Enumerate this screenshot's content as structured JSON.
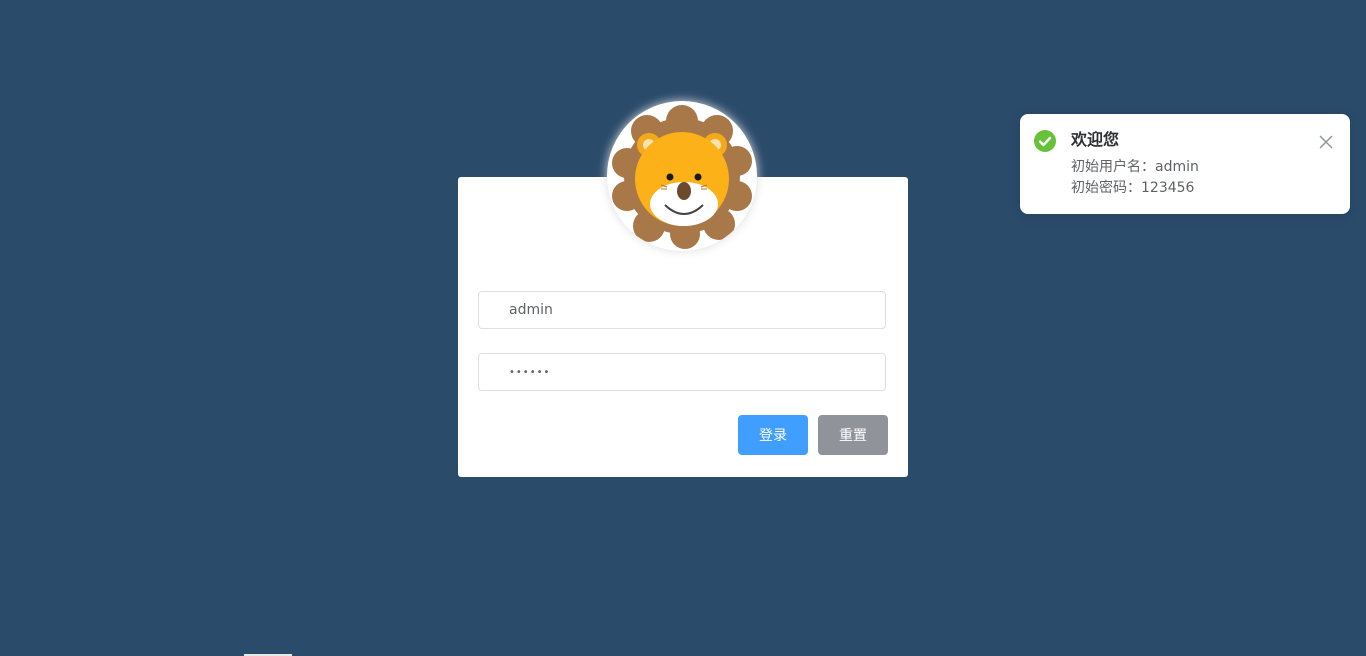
{
  "login_form": {
    "username_value": "admin",
    "password_value": "123456",
    "login_button_label": "登录",
    "reset_button_label": "重置"
  },
  "notification": {
    "title": "欢迎您",
    "line1": "初始用户名：admin",
    "line2": "初始密码：123456",
    "icon": "success-check-icon",
    "close_icon": "close-icon"
  },
  "avatar": {
    "icon": "lion-avatar"
  },
  "colors": {
    "background": "#2b4b6b",
    "primary": "#409eff",
    "info": "#909399",
    "success": "#67c23a"
  }
}
